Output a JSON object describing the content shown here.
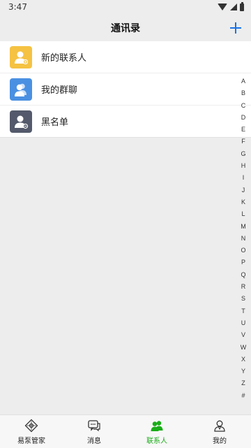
{
  "status_bar": {
    "time": "3:47"
  },
  "header": {
    "title": "通讯录",
    "add_icon": "plus-icon"
  },
  "list": [
    {
      "label": "新的联系人",
      "icon": "new-contact-icon",
      "color": "#f5c242"
    },
    {
      "label": "我的群聊",
      "icon": "group-chat-icon",
      "color": "#4a90e2"
    },
    {
      "label": "黑名单",
      "icon": "blacklist-icon",
      "color": "#545a6b"
    }
  ],
  "index_letters": [
    "A",
    "B",
    "C",
    "D",
    "E",
    "F",
    "G",
    "H",
    "I",
    "J",
    "K",
    "L",
    "M",
    "N",
    "O",
    "P",
    "Q",
    "R",
    "S",
    "T",
    "U",
    "V",
    "W",
    "X",
    "Y",
    "Z",
    "#"
  ],
  "bottom_nav": [
    {
      "label": "易泵管家",
      "icon": "home-diamond-icon",
      "active": false
    },
    {
      "label": "消息",
      "icon": "message-icon",
      "active": false
    },
    {
      "label": "联系人",
      "icon": "contacts-icon",
      "active": true
    },
    {
      "label": "我的",
      "icon": "profile-icon",
      "active": false
    }
  ],
  "colors": {
    "accent": "#1aad19",
    "add_button": "#1a73e8",
    "background": "#ededed"
  }
}
